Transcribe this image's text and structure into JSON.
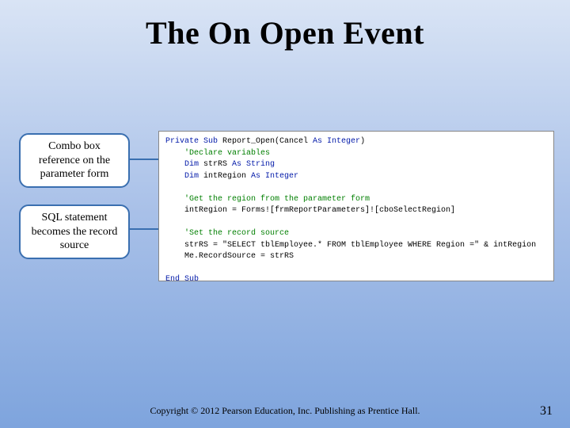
{
  "title": "The On Open Event",
  "callouts": {
    "c1": "Combo box reference on the parameter form",
    "c2": "SQL statement becomes the record source"
  },
  "code": {
    "l1a": "Private Sub",
    "l1b": " Report_Open(Cancel ",
    "l1c": "As Integer",
    "l1d": ")",
    "l2": "    'Declare variables",
    "l3a": "    Dim",
    "l3b": " strRS ",
    "l3c": "As String",
    "l4a": "    Dim",
    "l4b": " intRegion ",
    "l4c": "As Integer",
    "l5": "",
    "l6": "    'Get the region from the parameter form",
    "l7": "    intRegion = Forms![frmReportParameters]![cboSelectRegion]",
    "l8": "",
    "l9": "    'Set the record source",
    "l10": "    strRS = \"SELECT tblEmployee.* FROM tblEmployee WHERE Region =\" & intRegion",
    "l11": "    Me.RecordSource = strRS",
    "l12": "",
    "l13": "End Sub"
  },
  "footer": "Copyright © 2012 Pearson Education, Inc. Publishing as Prentice Hall.",
  "page": "31"
}
